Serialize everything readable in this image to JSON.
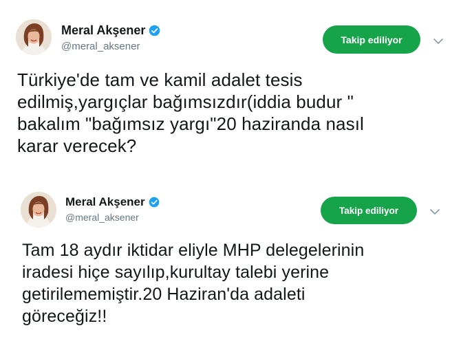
{
  "tweets": [
    {
      "user": {
        "display_name": "Meral Akşener",
        "handle": "@meral_aksener",
        "verified_icon": "verified-badge-icon",
        "avatar": "profile-photo"
      },
      "follow_label": "Takip ediliyor",
      "menu_icon": "chevron-down-icon",
      "text": "Türkiye'de tam ve kamil adalet tesis\nedilmiş,yargıçlar bağımsızdır(iddia budur \"\nbakalım \"bağımsız yargı\"20 haziranda nasıl\nkarar verecek?"
    },
    {
      "user": {
        "display_name": "Meral Akşener",
        "handle": "@meral_aksener",
        "verified_icon": "verified-badge-icon",
        "avatar": "profile-photo"
      },
      "follow_label": "Takip ediliyor",
      "menu_icon": "chevron-down-icon",
      "text": "Tam 18 aydır iktidar eliyle MHP delegelerinin\niradesi hiçe sayılıp,kurultay talebi yerine\ngetirilememiştir.20 Haziran'da adaleti\ngöreceğiz!!"
    }
  ],
  "colors": {
    "follow_button_bg": "#17a34a",
    "verified_blue": "#1da1f2",
    "handle_gray": "#657786",
    "text_dark": "#14171a"
  }
}
